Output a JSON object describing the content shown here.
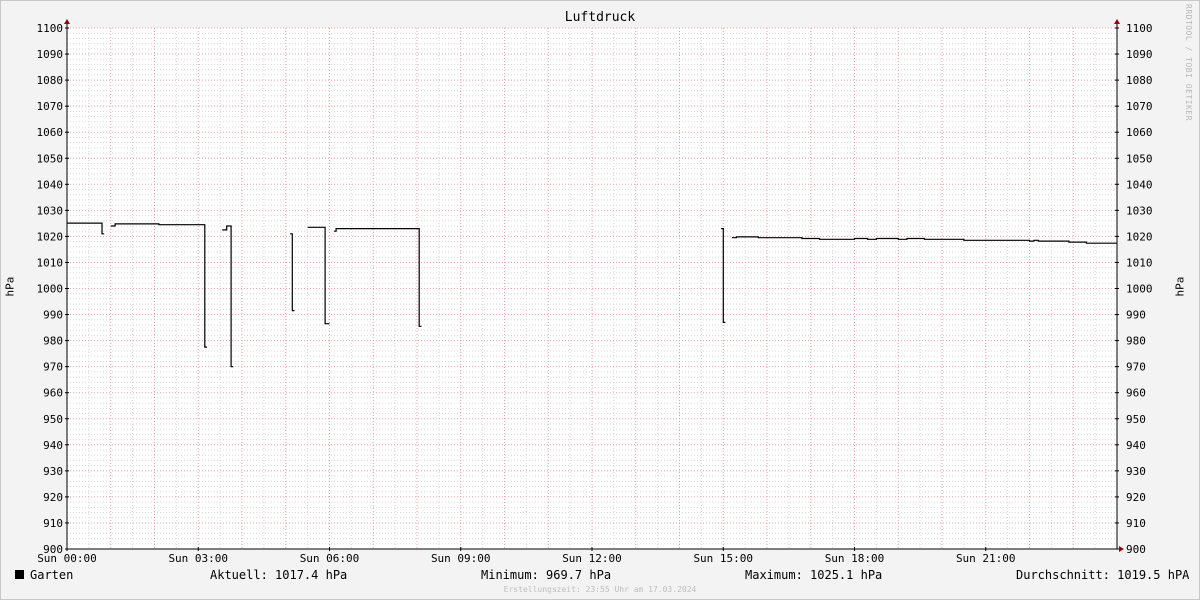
{
  "chart_data": {
    "type": "line",
    "title": "Luftdruck",
    "ylabel": "hPa",
    "ylim": [
      900,
      1100
    ],
    "yticks": [
      900,
      910,
      920,
      930,
      940,
      950,
      960,
      970,
      980,
      990,
      1000,
      1010,
      1020,
      1030,
      1040,
      1050,
      1060,
      1070,
      1080,
      1090,
      1100
    ],
    "xlim": [
      0,
      24
    ],
    "xticks": [
      {
        "value": 0,
        "label": "Sun 00:00"
      },
      {
        "value": 3,
        "label": "Sun 03:00"
      },
      {
        "value": 6,
        "label": "Sun 06:00"
      },
      {
        "value": 9,
        "label": "Sun 09:00"
      },
      {
        "value": 12,
        "label": "Sun 12:00"
      },
      {
        "value": 15,
        "label": "Sun 15:00"
      },
      {
        "value": 18,
        "label": "Sun 18:00"
      },
      {
        "value": 21,
        "label": "Sun 21:00"
      }
    ],
    "grid": true,
    "series": [
      {
        "name": "Garten",
        "color": "#000000",
        "segments": [
          [
            [
              0.0,
              1025.1
            ],
            [
              0.8,
              1025.1
            ],
            [
              0.8,
              1021.0
            ],
            [
              0.85,
              1021.0
            ]
          ],
          [
            [
              1.0,
              1024.0
            ],
            [
              1.1,
              1024.0
            ],
            [
              1.1,
              1024.8
            ],
            [
              2.1,
              1024.8
            ],
            [
              2.1,
              1024.5
            ],
            [
              3.15,
              1024.5
            ],
            [
              3.15,
              977.5
            ],
            [
              3.2,
              977.5
            ]
          ],
          [
            [
              3.55,
              1022.5
            ],
            [
              3.65,
              1022.5
            ],
            [
              3.65,
              1024.0
            ],
            [
              3.75,
              1024.0
            ],
            [
              3.75,
              970.0
            ],
            [
              3.8,
              970.0
            ]
          ],
          [
            [
              5.1,
              1021.0
            ],
            [
              5.15,
              1021.0
            ],
            [
              5.15,
              991.5
            ],
            [
              5.2,
              991.5
            ]
          ],
          [
            [
              5.5,
              1023.5
            ],
            [
              5.9,
              1023.5
            ],
            [
              5.9,
              986.5
            ],
            [
              6.0,
              986.5
            ]
          ],
          [
            [
              6.1,
              1022.0
            ],
            [
              6.15,
              1022.0
            ],
            [
              6.15,
              1023.0
            ],
            [
              8.05,
              1023.0
            ],
            [
              8.05,
              985.5
            ],
            [
              8.1,
              985.5
            ]
          ],
          [
            [
              14.95,
              1023.0
            ],
            [
              15.0,
              1023.0
            ],
            [
              15.0,
              987.0
            ],
            [
              15.05,
              987.0
            ]
          ],
          [
            [
              15.2,
              1019.5
            ],
            [
              15.3,
              1019.5
            ],
            [
              15.3,
              1019.8
            ],
            [
              15.8,
              1019.8
            ],
            [
              15.8,
              1019.5
            ],
            [
              16.8,
              1019.5
            ],
            [
              16.8,
              1019.2
            ],
            [
              17.2,
              1019.2
            ],
            [
              17.2,
              1018.9
            ],
            [
              18.0,
              1018.9
            ],
            [
              18.0,
              1019.2
            ],
            [
              18.3,
              1019.2
            ],
            [
              18.3,
              1018.9
            ],
            [
              18.5,
              1018.9
            ],
            [
              18.5,
              1019.2
            ],
            [
              19.0,
              1019.2
            ],
            [
              19.0,
              1018.9
            ],
            [
              19.2,
              1018.9
            ],
            [
              19.2,
              1019.2
            ],
            [
              19.6,
              1019.2
            ],
            [
              19.6,
              1018.9
            ],
            [
              20.5,
              1018.9
            ],
            [
              20.5,
              1018.5
            ],
            [
              22.0,
              1018.5
            ],
            [
              22.0,
              1018.2
            ],
            [
              22.1,
              1018.2
            ],
            [
              22.1,
              1018.5
            ],
            [
              22.2,
              1018.5
            ],
            [
              22.2,
              1018.2
            ],
            [
              22.9,
              1018.2
            ],
            [
              22.9,
              1017.8
            ],
            [
              23.3,
              1017.8
            ],
            [
              23.3,
              1017.4
            ],
            [
              24.0,
              1017.4
            ]
          ]
        ]
      }
    ]
  },
  "legend": {
    "name": "Garten",
    "current": "Aktuell: 1017.4 hPa",
    "minimum": "Minimum: 969.7 hPa",
    "maximum": "Maximum: 1025.1 hPa",
    "average": "Durchschnitt: 1019.5 hPA"
  },
  "watermark": "RRDTOOL / TOBI OETIKER",
  "footer": "Erstellungszeit: 23:55 Uhr am 17.03.2024",
  "colors": {
    "background": "#f3f3f3",
    "plot_background": "#ffffff",
    "minor_grid": "#d8d8d8",
    "major_grid": "#e8a0a0",
    "axis": "#a00000",
    "line": "#000000"
  }
}
